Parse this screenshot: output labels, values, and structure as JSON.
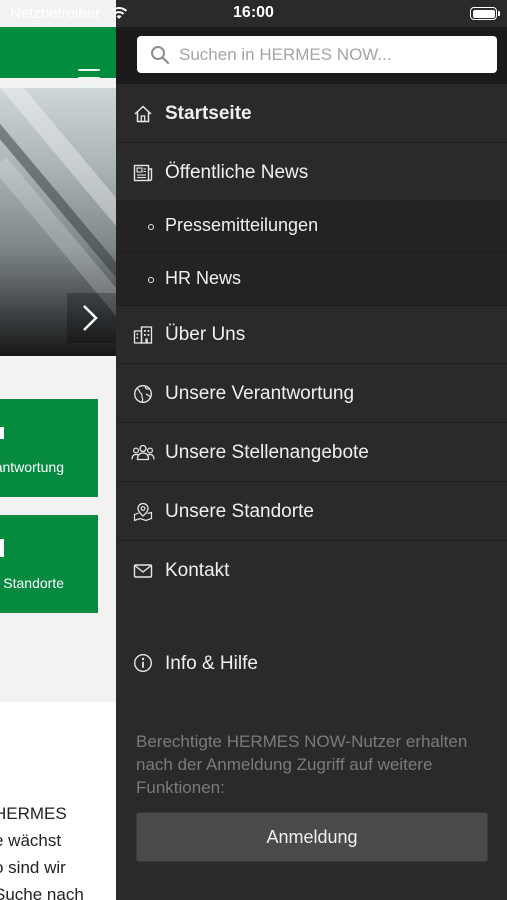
{
  "status_bar": {
    "carrier": "Netzbetreiber",
    "time": "16:00"
  },
  "background_page": {
    "tiles": [
      {
        "label": "Unsere Verantwortung"
      },
      {
        "label": "Unsere Standorte"
      }
    ],
    "text_lines": [
      "HERMES",
      "e wächst",
      "o sind wir",
      "Suche nach"
    ]
  },
  "drawer": {
    "search": {
      "placeholder": "Suchen in HERMES NOW..."
    },
    "nav": {
      "startseite": "Startseite",
      "news": "Öffentliche News",
      "pressemitteilungen": "Pressemitteilungen",
      "hr_news": "HR News",
      "ueber_uns": "Über Uns",
      "verantwortung": "Unsere Verantwortung",
      "stellenangebote": "Unsere Stellenangebote",
      "standorte": "Unsere Standorte",
      "kontakt": "Kontakt"
    },
    "info": "Info & Hilfe",
    "login_note": "Berechtigte HERMES NOW-Nutzer erhalten nach der Anmeldung Zugriff auf weitere Funktionen:",
    "login_button": "Anmeldung"
  },
  "colors": {
    "brand_green": "#008c3c",
    "drawer_bg": "#2a2a2a"
  }
}
